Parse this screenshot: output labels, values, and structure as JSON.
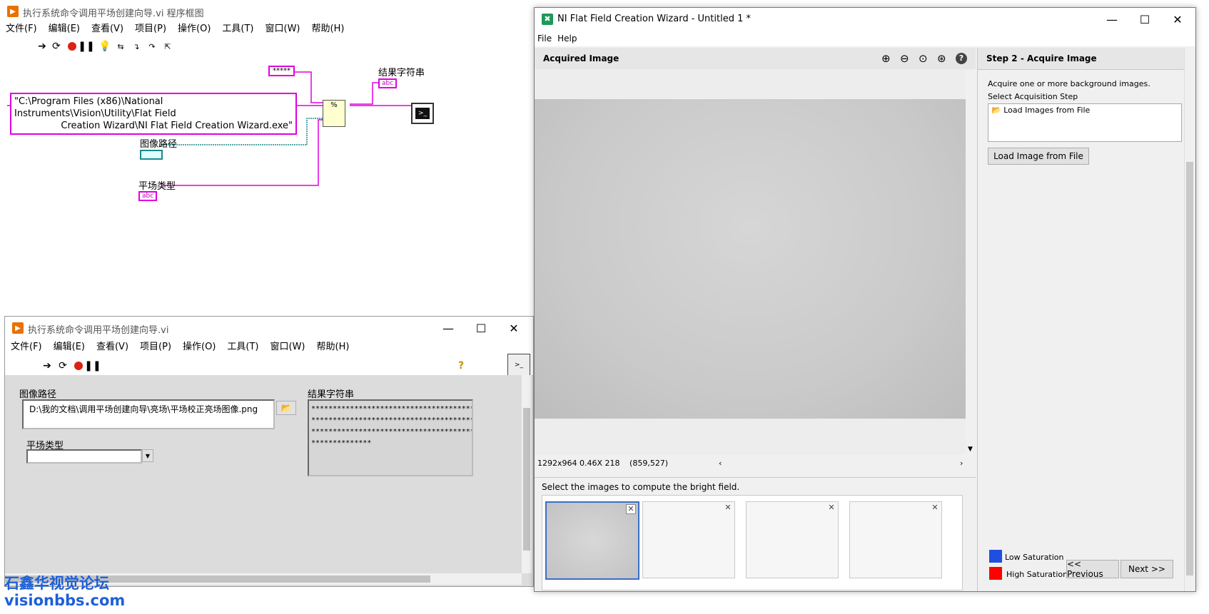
{
  "block_diagram": {
    "title": "执行系统命令调用平场创建向导.vi 程序框图",
    "menu": [
      "文件(F)",
      "编辑(E)",
      "查看(V)",
      "项目(P)",
      "操作(O)",
      "工具(T)",
      "窗口(W)",
      "帮助(H)"
    ],
    "string_const_stars": "*****",
    "path_const_line1": "\"C:\\Program Files (x86)\\National Instruments\\Vision\\Utility\\Flat Field",
    "path_const_line2": "Creation Wizard\\NI Flat Field Creation Wizard.exe\"",
    "label_image_path": "图像路径",
    "label_flat_type": "平场类型",
    "label_result": "结果字符串",
    "format_node": "%",
    "abc": "abc"
  },
  "front_panel": {
    "title": "执行系统命令调用平场创建向导.vi",
    "menu": [
      "文件(F)",
      "编辑(E)",
      "查看(V)",
      "项目(P)",
      "操作(O)",
      "工具(T)",
      "窗口(W)",
      "帮助(H)"
    ],
    "image_path_label": "图像路径",
    "image_path_value": "D:\\我的文档\\调用平场创建向导\\亮场\\平场校正亮场图像.png",
    "flat_type_label": "平场类型",
    "flat_type_value": "",
    "result_label": "结果字符串",
    "result_lines": [
      "**********************************************",
      "**********************************************",
      "**********************************************",
      "**************"
    ]
  },
  "wizard": {
    "title": "NI Flat Field Creation Wizard - Untitled 1 *",
    "menu": [
      "File",
      "Help"
    ],
    "image_panel_title": "Acquired Image",
    "status_size": "1292x964 0.46X 218",
    "status_coord": "(859,527)",
    "select_text": "Select the images to compute the bright field.",
    "step_title": "Step 2 - Acquire Image",
    "step_desc": "Acquire one or more background images.",
    "select_step_label": "Select Acquisition Step",
    "list_item": "Load Images from File",
    "load_button": "Load Image from File",
    "low_sat_label": "Low Saturation",
    "high_sat_label": "High Saturation",
    "prev_button": "<< Previous",
    "next_button": "Next >>",
    "colors": {
      "low_saturation": "#1f4fe0",
      "high_saturation": "#ff0000",
      "selected_thumb": "#3a6ec8"
    }
  },
  "watermark": {
    "line1": "石鑫华视觉论坛",
    "line2": "visionbbs.com"
  }
}
